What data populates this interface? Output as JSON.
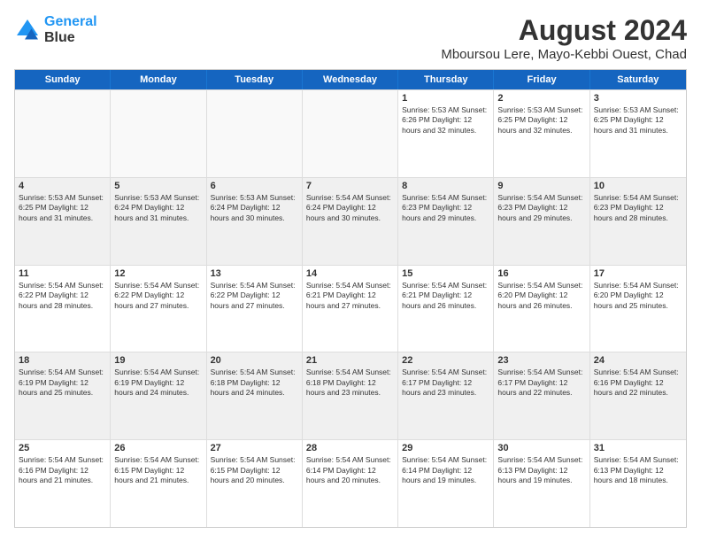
{
  "logo": {
    "line1": "General",
    "line2": "Blue"
  },
  "title": "August 2024",
  "subtitle": "Mboursou Lere, Mayo-Kebbi Ouest, Chad",
  "header_days": [
    "Sunday",
    "Monday",
    "Tuesday",
    "Wednesday",
    "Thursday",
    "Friday",
    "Saturday"
  ],
  "weeks": [
    [
      {
        "num": "",
        "info": "",
        "empty": true
      },
      {
        "num": "",
        "info": "",
        "empty": true
      },
      {
        "num": "",
        "info": "",
        "empty": true
      },
      {
        "num": "",
        "info": "",
        "empty": true
      },
      {
        "num": "1",
        "info": "Sunrise: 5:53 AM\nSunset: 6:26 PM\nDaylight: 12 hours\nand 32 minutes."
      },
      {
        "num": "2",
        "info": "Sunrise: 5:53 AM\nSunset: 6:25 PM\nDaylight: 12 hours\nand 32 minutes."
      },
      {
        "num": "3",
        "info": "Sunrise: 5:53 AM\nSunset: 6:25 PM\nDaylight: 12 hours\nand 31 minutes."
      }
    ],
    [
      {
        "num": "4",
        "info": "Sunrise: 5:53 AM\nSunset: 6:25 PM\nDaylight: 12 hours\nand 31 minutes.",
        "shaded": true
      },
      {
        "num": "5",
        "info": "Sunrise: 5:53 AM\nSunset: 6:24 PM\nDaylight: 12 hours\nand 31 minutes.",
        "shaded": true
      },
      {
        "num": "6",
        "info": "Sunrise: 5:53 AM\nSunset: 6:24 PM\nDaylight: 12 hours\nand 30 minutes.",
        "shaded": true
      },
      {
        "num": "7",
        "info": "Sunrise: 5:54 AM\nSunset: 6:24 PM\nDaylight: 12 hours\nand 30 minutes.",
        "shaded": true
      },
      {
        "num": "8",
        "info": "Sunrise: 5:54 AM\nSunset: 6:23 PM\nDaylight: 12 hours\nand 29 minutes.",
        "shaded": true
      },
      {
        "num": "9",
        "info": "Sunrise: 5:54 AM\nSunset: 6:23 PM\nDaylight: 12 hours\nand 29 minutes.",
        "shaded": true
      },
      {
        "num": "10",
        "info": "Sunrise: 5:54 AM\nSunset: 6:23 PM\nDaylight: 12 hours\nand 28 minutes.",
        "shaded": true
      }
    ],
    [
      {
        "num": "11",
        "info": "Sunrise: 5:54 AM\nSunset: 6:22 PM\nDaylight: 12 hours\nand 28 minutes."
      },
      {
        "num": "12",
        "info": "Sunrise: 5:54 AM\nSunset: 6:22 PM\nDaylight: 12 hours\nand 27 minutes."
      },
      {
        "num": "13",
        "info": "Sunrise: 5:54 AM\nSunset: 6:22 PM\nDaylight: 12 hours\nand 27 minutes."
      },
      {
        "num": "14",
        "info": "Sunrise: 5:54 AM\nSunset: 6:21 PM\nDaylight: 12 hours\nand 27 minutes."
      },
      {
        "num": "15",
        "info": "Sunrise: 5:54 AM\nSunset: 6:21 PM\nDaylight: 12 hours\nand 26 minutes."
      },
      {
        "num": "16",
        "info": "Sunrise: 5:54 AM\nSunset: 6:20 PM\nDaylight: 12 hours\nand 26 minutes."
      },
      {
        "num": "17",
        "info": "Sunrise: 5:54 AM\nSunset: 6:20 PM\nDaylight: 12 hours\nand 25 minutes."
      }
    ],
    [
      {
        "num": "18",
        "info": "Sunrise: 5:54 AM\nSunset: 6:19 PM\nDaylight: 12 hours\nand 25 minutes.",
        "shaded": true
      },
      {
        "num": "19",
        "info": "Sunrise: 5:54 AM\nSunset: 6:19 PM\nDaylight: 12 hours\nand 24 minutes.",
        "shaded": true
      },
      {
        "num": "20",
        "info": "Sunrise: 5:54 AM\nSunset: 6:18 PM\nDaylight: 12 hours\nand 24 minutes.",
        "shaded": true
      },
      {
        "num": "21",
        "info": "Sunrise: 5:54 AM\nSunset: 6:18 PM\nDaylight: 12 hours\nand 23 minutes.",
        "shaded": true
      },
      {
        "num": "22",
        "info": "Sunrise: 5:54 AM\nSunset: 6:17 PM\nDaylight: 12 hours\nand 23 minutes.",
        "shaded": true
      },
      {
        "num": "23",
        "info": "Sunrise: 5:54 AM\nSunset: 6:17 PM\nDaylight: 12 hours\nand 22 minutes.",
        "shaded": true
      },
      {
        "num": "24",
        "info": "Sunrise: 5:54 AM\nSunset: 6:16 PM\nDaylight: 12 hours\nand 22 minutes.",
        "shaded": true
      }
    ],
    [
      {
        "num": "25",
        "info": "Sunrise: 5:54 AM\nSunset: 6:16 PM\nDaylight: 12 hours\nand 21 minutes."
      },
      {
        "num": "26",
        "info": "Sunrise: 5:54 AM\nSunset: 6:15 PM\nDaylight: 12 hours\nand 21 minutes."
      },
      {
        "num": "27",
        "info": "Sunrise: 5:54 AM\nSunset: 6:15 PM\nDaylight: 12 hours\nand 20 minutes."
      },
      {
        "num": "28",
        "info": "Sunrise: 5:54 AM\nSunset: 6:14 PM\nDaylight: 12 hours\nand 20 minutes."
      },
      {
        "num": "29",
        "info": "Sunrise: 5:54 AM\nSunset: 6:14 PM\nDaylight: 12 hours\nand 19 minutes."
      },
      {
        "num": "30",
        "info": "Sunrise: 5:54 AM\nSunset: 6:13 PM\nDaylight: 12 hours\nand 19 minutes."
      },
      {
        "num": "31",
        "info": "Sunrise: 5:54 AM\nSunset: 6:13 PM\nDaylight: 12 hours\nand 18 minutes."
      }
    ]
  ]
}
